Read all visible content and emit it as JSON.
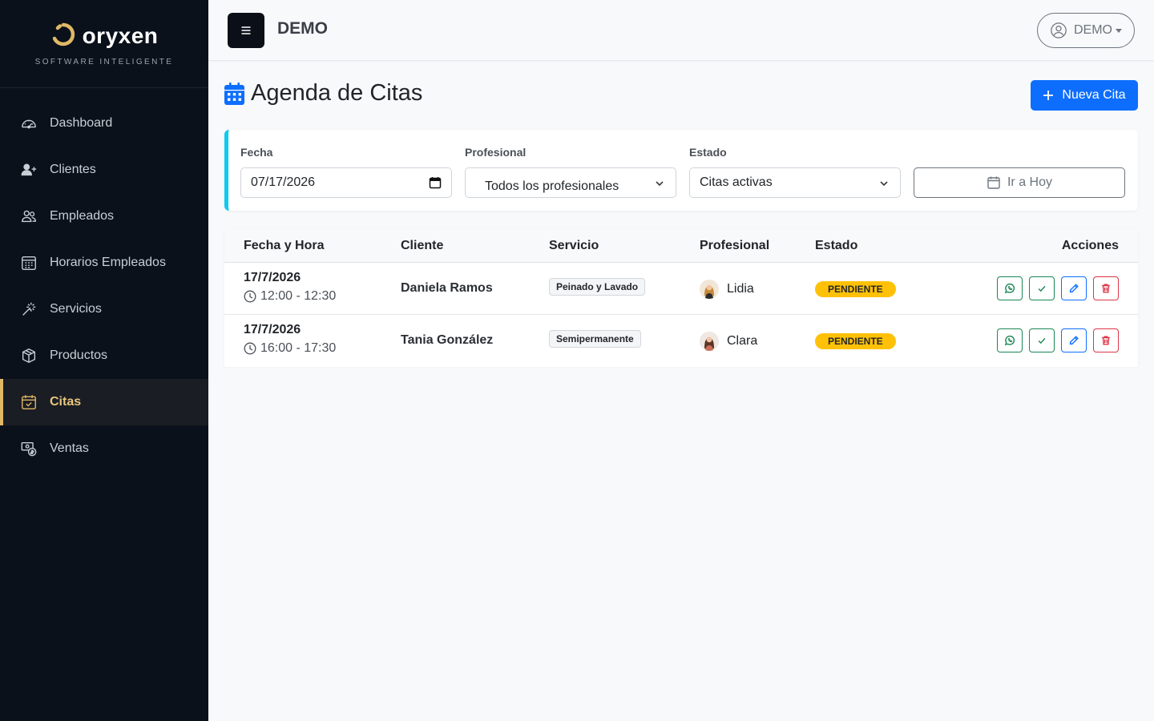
{
  "brand": {
    "name": "oryxen",
    "tagline": "SOFTWARE INTELIGENTE",
    "accent": "#e1b866"
  },
  "sidebar": {
    "items": [
      {
        "label": "Dashboard",
        "icon": "speedometer-icon",
        "active": false
      },
      {
        "label": "Clientes",
        "icon": "person-plus-icon",
        "active": false
      },
      {
        "label": "Empleados",
        "icon": "people-icon",
        "active": false
      },
      {
        "label": "Horarios Empleados",
        "icon": "calendar-grid-icon",
        "active": false
      },
      {
        "label": "Servicios",
        "icon": "magic-wand-icon",
        "active": false
      },
      {
        "label": "Productos",
        "icon": "box-icon",
        "active": false
      },
      {
        "label": "Citas",
        "icon": "calendar-check-icon",
        "active": true
      },
      {
        "label": "Ventas",
        "icon": "cash-coin-icon",
        "active": false
      }
    ]
  },
  "topbar": {
    "title": "DEMO",
    "user_label": "DEMO"
  },
  "page": {
    "title": "Agenda de Citas",
    "new_button": "Nueva Cita"
  },
  "filters": {
    "fecha": {
      "label": "Fecha",
      "value": "07/17/2026"
    },
    "profesional": {
      "label": "Profesional",
      "value": "Todos los profesionales"
    },
    "estado": {
      "label": "Estado",
      "value": "Citas activas"
    },
    "today_button": "Ir a Hoy"
  },
  "table": {
    "headers": [
      "Fecha y Hora",
      "Cliente",
      "Servicio",
      "Profesional",
      "Estado",
      "Acciones"
    ],
    "rows": [
      {
        "date": "17/7/2026",
        "time": "12:00 - 12:30",
        "client": "Daniela Ramos",
        "service": "Peinado y Lavado",
        "professional": "Lidia",
        "status": "PENDIENTE"
      },
      {
        "date": "17/7/2026",
        "time": "16:00 - 17:30",
        "client": "Tania González",
        "service": "Semipermanente",
        "professional": "Clara",
        "status": "PENDIENTE"
      }
    ]
  },
  "colors": {
    "primary": "#0d6efd",
    "info": "#0dcaf0",
    "warning": "#ffc107",
    "success": "#198754",
    "danger": "#dc3545",
    "sidebar_bg": "#0b111b"
  }
}
